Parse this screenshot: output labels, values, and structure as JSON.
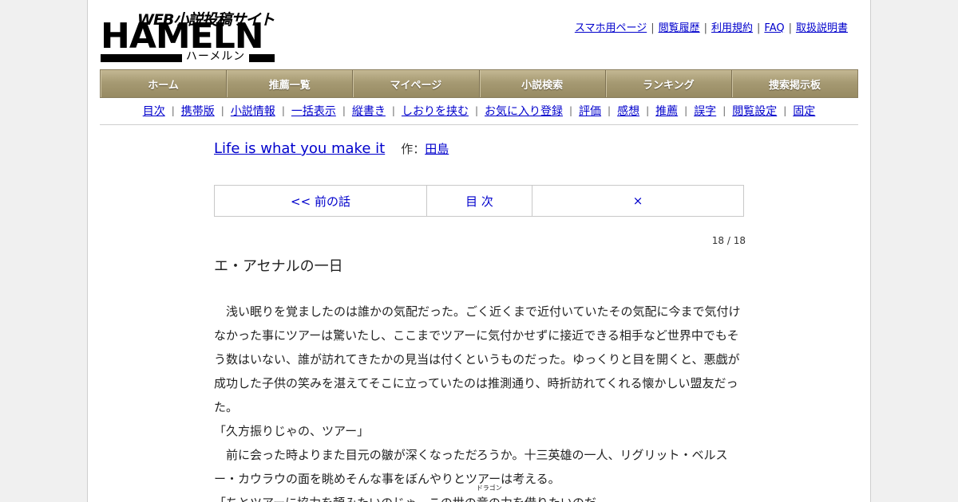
{
  "logo": {
    "sub": "WEB小説投稿サイト",
    "main": "HAMELN",
    "kana": "ハーメルン"
  },
  "toplinks": [
    "スマホ用ページ",
    "閲覧履歴",
    "利用規約",
    "FAQ",
    "取扱説明書"
  ],
  "nav": [
    "ホーム",
    "推薦一覧",
    "マイページ",
    "小説検索",
    "ランキング",
    "捜索掲示板"
  ],
  "subnav": [
    "目次",
    "携帯版",
    "小説情報",
    "一括表示",
    "縦書き",
    "しおりを挟む",
    "お気に入り登録",
    "評価",
    "感想",
    "推薦",
    "誤字",
    "閲覧設定",
    "固定"
  ],
  "novel": {
    "title": "Life is what you make it",
    "author_label": "作：",
    "author": "田島",
    "pager": {
      "prev": "<< 前の話",
      "toc": "目 次",
      "close": "×"
    },
    "count": "18 / 18",
    "chapter_title": "エ・アセナルの一日",
    "paragraphs": [
      "　浅い眠りを覚ましたのは誰かの気配だった。ごく近くまで近付いていたその気配に今まで気付けなかった事にツアーは驚いたし、ここまでツアーに気付かせずに接近できる相手など世界中でもそう数はいない、誰が訪れてきたかの見当は付くというものだった。ゆっくりと目を開くと、悪戯が成功した子供の笑みを湛えてそこに立っていたのは推測通り、時折訪れてくれる懐かしい盟友だった。",
      "「久方振りじゃの、ツアー」",
      "　前に会った時よりまた目元の皺が深くなっただろうか。十三英雄の一人、リグリット・ベルスー・カウラウの面を眺めそんな事をぼんやりとツアーは考える。",
      "「ちとツアーに協力を頼みたいのじゃ。この世の"
    ],
    "ruby_base": "竜",
    "ruby_text": "ドラゴン",
    "last_after": "の力を借りたいのだ。"
  }
}
